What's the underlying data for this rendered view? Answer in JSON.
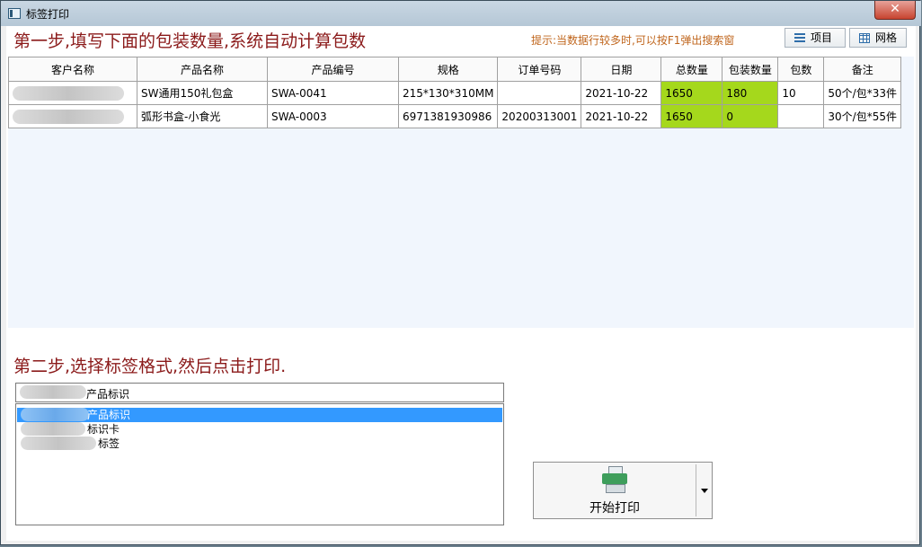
{
  "window": {
    "title": "标签打印",
    "close_label": "✕"
  },
  "step1": {
    "text": "第一步,填写下面的包装数量,系统自动计算包数",
    "hint": "提示:当数据行较多时,可以按F1弹出搜索窗",
    "btn_items": "项目",
    "btn_grid": "网格"
  },
  "table": {
    "columns": [
      "客户名称",
      "产品名称",
      "产品编号",
      "规格",
      "订单号码",
      "日期",
      "总数量",
      "包装数量",
      "包数",
      "备注"
    ],
    "rows": [
      [
        "",
        "SW通用150礼包盒",
        "SWA-0041",
        "215*130*310MM",
        "",
        "2021-10-22",
        "1650",
        "180",
        "10",
        "50个/包*33件"
      ],
      [
        "",
        "弧形书盒-小食光",
        "SWA-0003",
        "6971381930986",
        "20200313001",
        "2021-10-22",
        "1650",
        "0",
        "",
        "30个/包*55件"
      ]
    ]
  },
  "colors": {
    "highlight": "#a5d81c",
    "step_text": "#8b1a1a",
    "hint_text": "#c0661d",
    "selection": "#3399ff"
  },
  "step2": {
    "text": "第二步,选择标签格式,然后点击打印.",
    "combo_value": "产品标识",
    "options": [
      "产品标识",
      "标识卡",
      "标签"
    ],
    "selected_index": 0
  },
  "print": {
    "label": "开始打印"
  }
}
